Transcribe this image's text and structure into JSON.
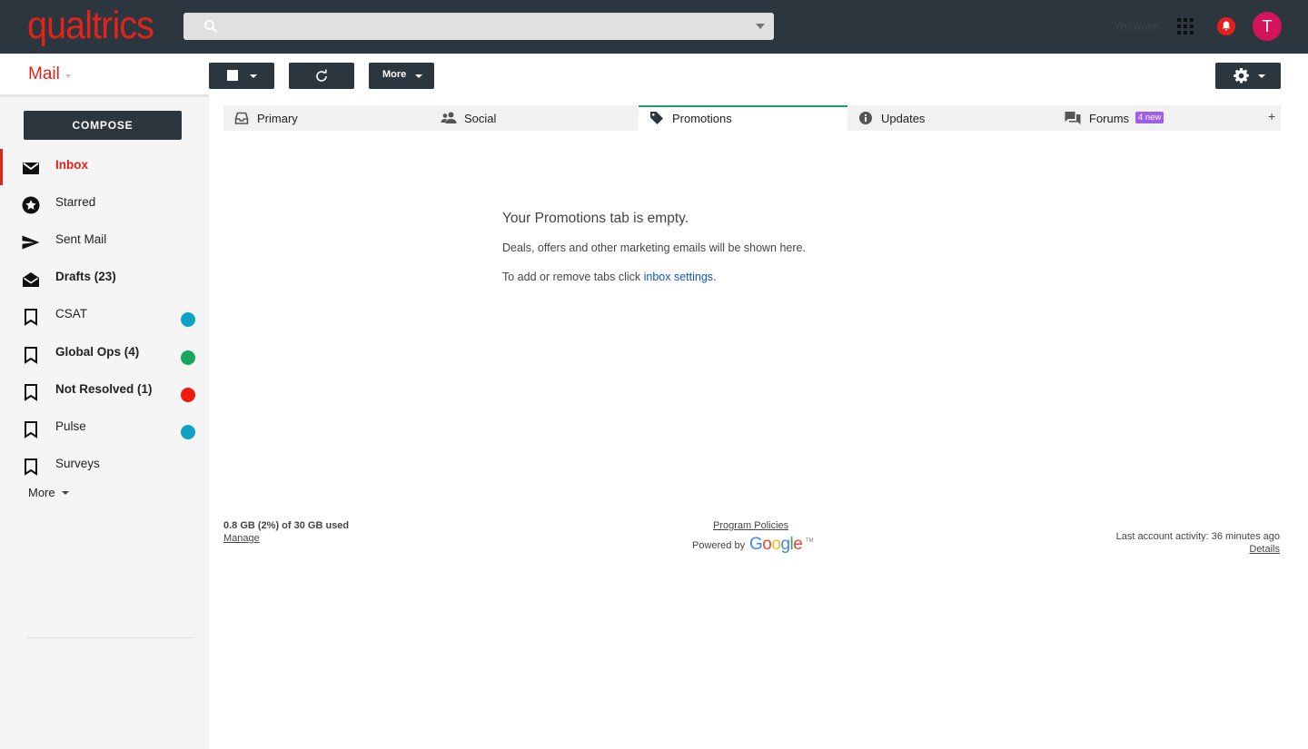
{
  "header": {
    "logo": "qualtrics",
    "account_name": "Yesware",
    "avatar_letter": "T"
  },
  "sidebar": {
    "title": "Mail",
    "compose_label": "COMPOSE",
    "items": [
      {
        "label": "Inbox",
        "icon": "inbox-icon"
      },
      {
        "label": "Starred",
        "icon": "star-icon"
      },
      {
        "label": "Sent Mail",
        "icon": "send-icon"
      },
      {
        "label": "Drafts (23)",
        "icon": "drafts-icon"
      },
      {
        "label": "CSAT",
        "icon": "label-icon",
        "color": "#0ea2c6"
      },
      {
        "label": "Global Ops (4)",
        "icon": "label-icon",
        "color": "#17a85d"
      },
      {
        "label": "Not Resolved (1)",
        "icon": "label-icon",
        "color": "#f01a0e"
      },
      {
        "label": "Pulse",
        "icon": "label-icon",
        "color": "#0ea2c6"
      },
      {
        "label": "Surveys",
        "icon": "label-icon"
      }
    ],
    "more_label": "More"
  },
  "toolbar": {
    "more_label": "More"
  },
  "tabs": [
    {
      "label": "Primary",
      "icon": "inbox-tray-icon"
    },
    {
      "label": "Social",
      "icon": "people-icon"
    },
    {
      "label": "Promotions",
      "icon": "tag-icon",
      "active": true
    },
    {
      "label": "Updates",
      "icon": "info-icon"
    },
    {
      "label": "Forums",
      "icon": "forum-icon",
      "badge": "4 new"
    }
  ],
  "add_tab_label": "+",
  "empty_state": {
    "title": "Your Promotions tab is empty.",
    "description": "Deals, offers and other marketing emails will be shown here.",
    "hint_prefix": "To add or remove tabs click ",
    "hint_link": "inbox settings",
    "hint_suffix": "."
  },
  "footer": {
    "storage": "0.8 GB (2%) of 30 GB used",
    "manage": "Manage",
    "program_policies": "Program Policies",
    "powered_by": "Powered by",
    "google": "Google",
    "trademark": "TM",
    "last_activity": "Last account activity: 36 minutes ago",
    "details": "Details"
  },
  "colors": {
    "brand": "#e2231a",
    "topbar": "#2c363e",
    "active_tab": "#1aa260",
    "badge": "#a05de6",
    "link": "#1155cc"
  }
}
